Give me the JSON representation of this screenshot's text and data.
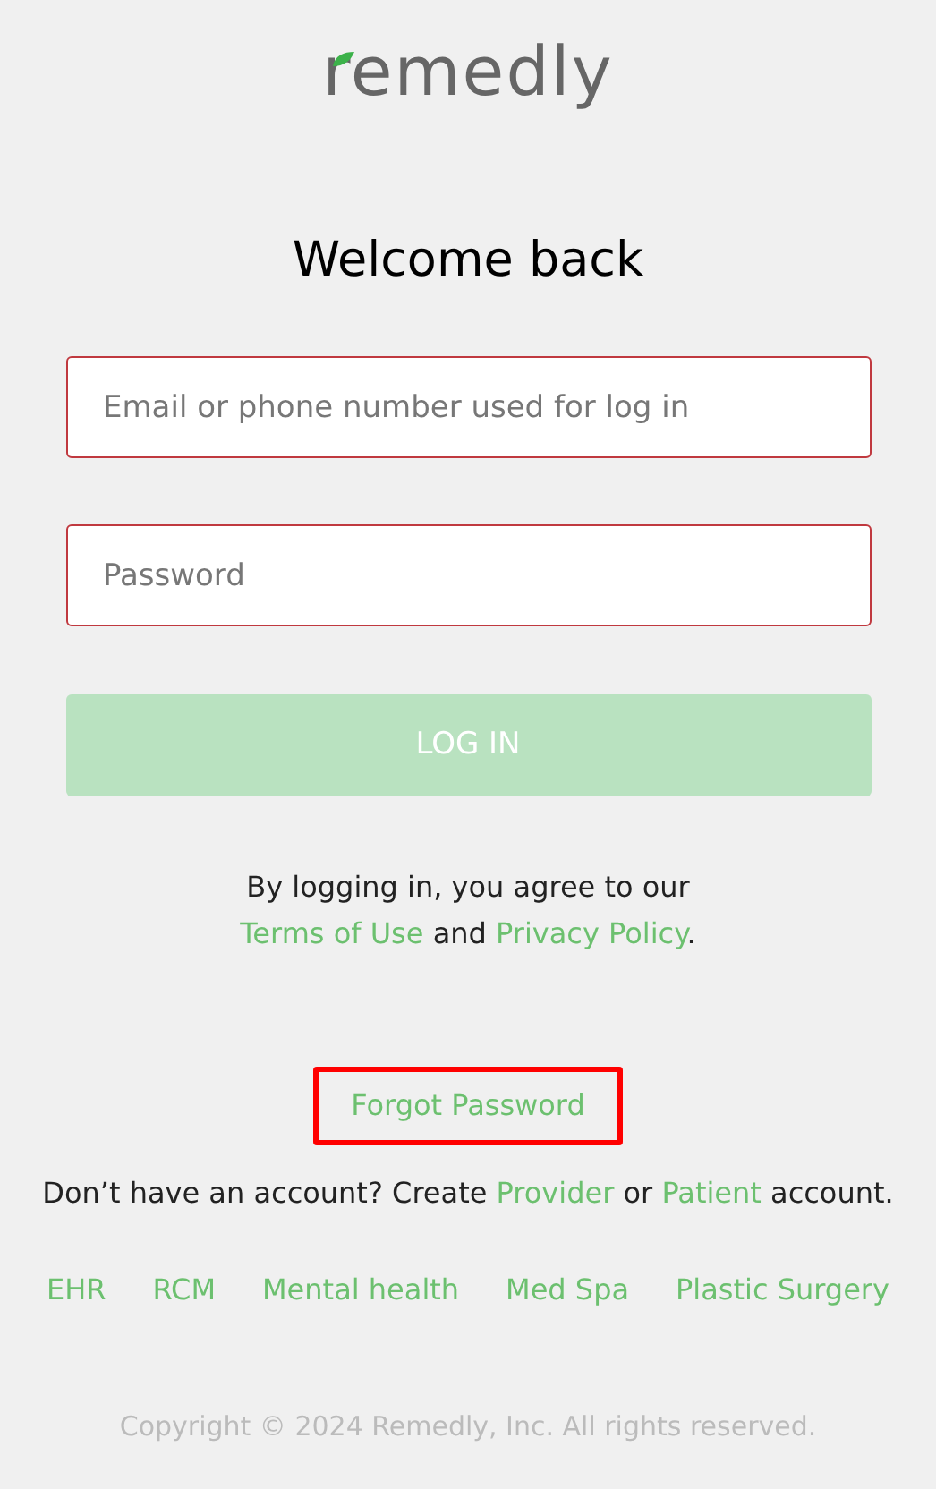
{
  "logo": {
    "text": "remedly"
  },
  "heading": "Welcome back",
  "fields": [
    {
      "placeholder": "Email or phone number used for log in"
    },
    {
      "placeholder": "Password"
    }
  ],
  "login_button": {
    "label": "LOG IN",
    "disabled": true
  },
  "agreement": {
    "line_1": "By logging in, you agree to our",
    "terms_link": "Terms of Use",
    "joiner": "and",
    "privacy_link": "Privacy Policy",
    "end": "."
  },
  "forgot_password": {
    "label": "Forgot Password",
    "highlighted": true
  },
  "signup": {
    "before": "Don’t have an account? Create",
    "provider_link": "Provider",
    "joiner": "or",
    "patient_link": "Patient",
    "after": "account."
  },
  "footer_links": [
    "EHR",
    "RCM",
    "Mental health",
    "Med Spa",
    "Plastic Surgery"
  ],
  "copyright": "Copyright © 2024 Remedly, Inc. All rights reserved."
}
